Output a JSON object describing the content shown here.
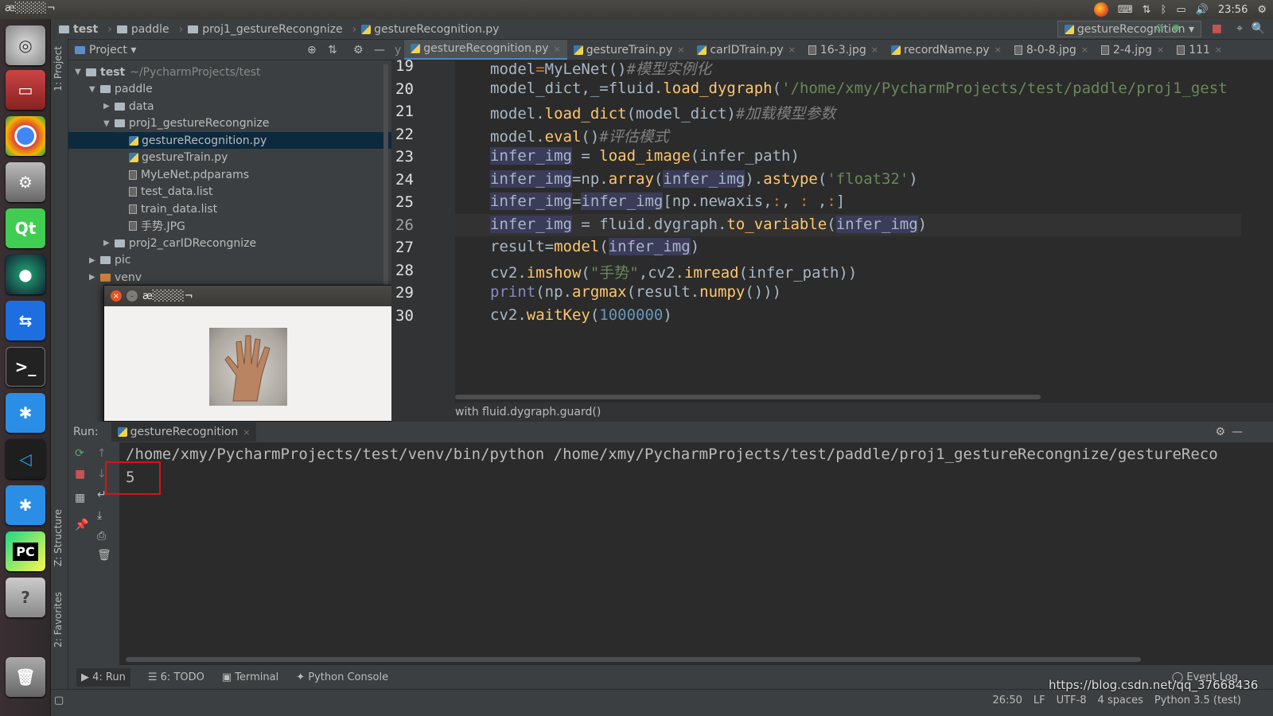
{
  "system": {
    "title": "æ░░░░¬",
    "clock": "23:56"
  },
  "breadcrumb": [
    "test",
    "paddle",
    "proj1_gestureRecongnize",
    "gestureRecognition.py"
  ],
  "run_config": "gestureRecognition",
  "project_panel": {
    "header": "Project",
    "tree": [
      {
        "label": "test",
        "suffix": "~/PycharmProjects/test",
        "indent": 0,
        "type": "folder",
        "open": true
      },
      {
        "label": "paddle",
        "indent": 1,
        "type": "folder",
        "open": true
      },
      {
        "label": "data",
        "indent": 2,
        "type": "folder",
        "open": false
      },
      {
        "label": "proj1_gestureRecongnize",
        "indent": 2,
        "type": "folder",
        "open": true
      },
      {
        "label": "gestureRecognition.py",
        "indent": 3,
        "type": "py",
        "selected": true
      },
      {
        "label": "gestureTrain.py",
        "indent": 3,
        "type": "py"
      },
      {
        "label": "MyLeNet.pdparams",
        "indent": 3,
        "type": "file"
      },
      {
        "label": "test_data.list",
        "indent": 3,
        "type": "file"
      },
      {
        "label": "train_data.list",
        "indent": 3,
        "type": "file"
      },
      {
        "label": "手势.JPG",
        "indent": 3,
        "type": "file"
      },
      {
        "label": "proj2_carIDRecongnize",
        "indent": 2,
        "type": "folder",
        "open": false
      },
      {
        "label": "pic",
        "indent": 1,
        "type": "folder",
        "open": false
      },
      {
        "label": "venv",
        "indent": 1,
        "type": "folder",
        "open": false
      }
    ]
  },
  "popup": {
    "title": "æ░░░░¬"
  },
  "tabs": [
    "gestureRecognition.py",
    "gestureTrain.py",
    "carIDTrain.py",
    "16-3.jpg",
    "recordName.py",
    "8-0-8.jpg",
    "2-4.jpg",
    "111"
  ],
  "code": {
    "line_numbers": [
      "19",
      "20",
      "21",
      "22",
      "23",
      "24",
      "25",
      "26",
      "27",
      "28",
      "29",
      "30"
    ],
    "current_line": "26",
    "breadcrumb_hint": "with fluid.dygraph.guard()"
  },
  "run": {
    "label": "Run:",
    "tab": "gestureRecognition",
    "command": "/home/xmy/PycharmProjects/test/venv/bin/python /home/xmy/PycharmProjects/test/paddle/proj1_gestureRecongnize/gestureReco",
    "output": "5"
  },
  "bottom_tabs": [
    "4: Run",
    "6: TODO",
    "Terminal",
    "Python Console"
  ],
  "event_log": "Event Log",
  "status": {
    "position": "26:50",
    "line_sep": "LF",
    "encoding": "UTF-8",
    "indent": "4 spaces",
    "interpreter": "Python 3.5 (test)"
  },
  "side_labels": {
    "project": "1: Project",
    "structure": "Z: Structure",
    "favorites": "2: Favorites"
  },
  "watermark": "https://blog.csdn.net/qq_37668436"
}
